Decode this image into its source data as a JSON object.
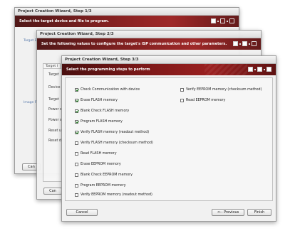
{
  "step1": {
    "title": "Project Creation Wizard, Step 1/3",
    "banner": "Select the target device and file to program.",
    "side_labels": [
      "Target D",
      "Image Fi"
    ],
    "cancel_label": "Can"
  },
  "step2": {
    "title": "Project Creation Wizard, Step 2/3",
    "banner": "Set the following values to configure the target's ISP communication and other parameters.",
    "tab_label": "Target I",
    "fields": [
      "Target",
      "Device",
      "Target",
      "Power s",
      "Power s",
      "Reset u",
      "Reset d"
    ],
    "cancel_label": "Can"
  },
  "step3": {
    "title": "Project Creation Wizard, Step 3/3",
    "banner": "Select the programming steps to perform",
    "left_steps": [
      {
        "label": "Check Communication with device",
        "checked": true
      },
      {
        "label": "Erase FLASH memory",
        "checked": true
      },
      {
        "label": "Blank Check FLASH memory",
        "checked": true
      },
      {
        "label": "Program FLASH memory",
        "checked": true
      },
      {
        "label": "Verify FLASH memory (readout method)",
        "checked": true
      },
      {
        "label": "Verify FLASH memory (checksum method)",
        "checked": false
      },
      {
        "label": "Read FLASH memory",
        "checked": false
      },
      {
        "label": "Erase EEPROM memory",
        "checked": false
      },
      {
        "label": "Blank Check EEPROM memory",
        "checked": false
      },
      {
        "label": "Program EEPROM memory",
        "checked": false
      },
      {
        "label": "Verify EEPROM memory (readout method)",
        "checked": false
      }
    ],
    "right_steps": [
      {
        "label": "Verify EEPROM memory (checksum method)",
        "checked": false
      },
      {
        "label": "Read EEPROM memory",
        "checked": false
      }
    ],
    "buttons": {
      "cancel": "Cancel",
      "previous": "<-- Previous",
      "finish": "Finish"
    }
  }
}
